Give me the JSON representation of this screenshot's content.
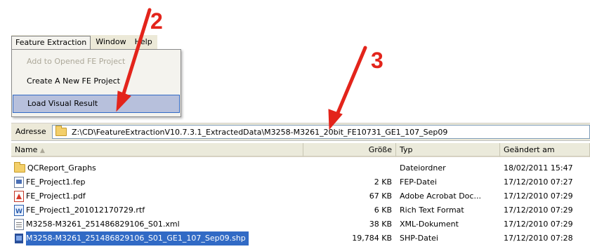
{
  "menu": {
    "items": [
      "Feature Extraction",
      "Window",
      "Help"
    ],
    "dropdown": [
      {
        "label": "Add to Opened FE Project",
        "disabled": true
      },
      {
        "label": "Create A New FE Project",
        "disabled": false
      },
      {
        "label": "Load Visual Result",
        "disabled": false,
        "selected": true
      }
    ]
  },
  "address": {
    "label": "Adresse",
    "path": "Z:\\CD\\FeatureExtractionV10.7.3.1_ExtractedData\\M3258-M3261_20bit_FE10731_GE1_107_Sep09"
  },
  "list": {
    "columns": {
      "name": "Name",
      "size": "Größe",
      "type": "Typ",
      "date": "Geändert am"
    },
    "files": [
      {
        "icon": "folder-icon",
        "name": "QCReport_Graphs",
        "size": "",
        "type": "Dateiordner",
        "date": "18/02/2011 15:47"
      },
      {
        "icon": "fep-file-icon",
        "name": "FE_Project1.fep",
        "size": "2 KB",
        "type": "FEP-Datei",
        "date": "17/12/2010 07:27"
      },
      {
        "icon": "pdf-file-icon",
        "name": "FE_Project1.pdf",
        "size": "67 KB",
        "type": "Adobe Acrobat Doc...",
        "date": "17/12/2010 07:29"
      },
      {
        "icon": "rtf-file-icon",
        "name": "FE_Project1_201012170729.rtf",
        "size": "6 KB",
        "type": "Rich Text Format",
        "date": "17/12/2010 07:29"
      },
      {
        "icon": "xml-file-icon",
        "name": "M3258-M3261_251486829106_S01.xml",
        "size": "38 KB",
        "type": "XML-Dokument",
        "date": "17/12/2010 07:29"
      },
      {
        "icon": "shp-file-icon",
        "name": "M3258-M3261_251486829106_S01_GE1_107_Sep09.shp",
        "size": "19,784 KB",
        "type": "SHP-Datei",
        "date": "17/12/2010 07:28",
        "selected": true
      }
    ]
  },
  "annotations": {
    "step2": "2",
    "step3": "3",
    "color": "#e3241b"
  },
  "colors": {
    "selection": "#316ac5",
    "menu_bg": "#ece9d8",
    "highlight": "#b7c0dc"
  }
}
